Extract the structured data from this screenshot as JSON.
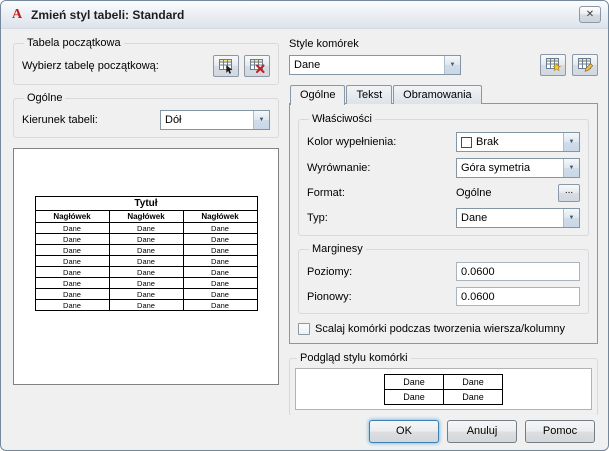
{
  "window": {
    "title": "Zmień styl tabeli: Standard"
  },
  "icons": {
    "app_logo": "A",
    "close": "✕",
    "dropdown_arrow": "▼",
    "ellipsis": "..."
  },
  "colors": {
    "dialog_bg": "#f0f0f0",
    "default_button_border": "#3c7fb1",
    "preview_grid": "#000000",
    "remove_icon_red": "#c81e1e"
  },
  "left": {
    "starting_table": {
      "title": "Tabela początkowa",
      "label": "Wybierz tabelę początkową:"
    },
    "general": {
      "title": "Ogólne",
      "direction_label": "Kierunek tabeli:",
      "direction_value": "Dół"
    },
    "table_preview": {
      "title_row": "Tytuł",
      "header_row": [
        "Nagłówek",
        "Nagłówek",
        "Nagłówek"
      ],
      "data_rows": [
        [
          "Dane",
          "Dane",
          "Dane"
        ],
        [
          "Dane",
          "Dane",
          "Dane"
        ],
        [
          "Dane",
          "Dane",
          "Dane"
        ],
        [
          "Dane",
          "Dane",
          "Dane"
        ],
        [
          "Dane",
          "Dane",
          "Dane"
        ],
        [
          "Dane",
          "Dane",
          "Dane"
        ],
        [
          "Dane",
          "Dane",
          "Dane"
        ],
        [
          "Dane",
          "Dane",
          "Dane"
        ]
      ]
    }
  },
  "right": {
    "cell_styles": {
      "title": "Style komórek",
      "selected": "Dane"
    },
    "tabs": [
      {
        "label": "Ogólne",
        "active": true
      },
      {
        "label": "Tekst",
        "active": false
      },
      {
        "label": "Obramowania",
        "active": false
      }
    ],
    "properties": {
      "title": "Właściwości",
      "fill_color_label": "Kolor wypełnienia:",
      "fill_color_value": "Brak",
      "alignment_label": "Wyrównanie:",
      "alignment_value": "Góra symetria",
      "format_label": "Format:",
      "format_value": "Ogólne",
      "type_label": "Typ:",
      "type_value": "Dane"
    },
    "margins": {
      "title": "Marginesy",
      "horizontal_label": "Poziomy:",
      "horizontal_value": "0.0600",
      "vertical_label": "Pionowy:",
      "vertical_value": "0.0600"
    },
    "merge_checkbox_label": "Scalaj komórki podczas tworzenia wiersza/kolumny",
    "cell_preview": {
      "title": "Podgląd stylu komórki",
      "rows": [
        [
          "Dane",
          "Dane"
        ],
        [
          "Dane",
          "Dane"
        ]
      ]
    }
  },
  "footer": {
    "ok": "OK",
    "cancel": "Anuluj",
    "help": "Pomoc"
  }
}
